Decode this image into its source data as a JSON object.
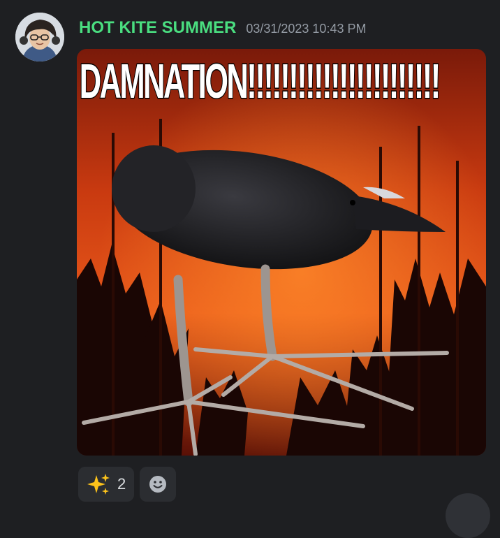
{
  "message": {
    "username": "HOT KITE SUMMER",
    "timestamp": "03/31/2023 10:43 PM",
    "username_color": "#4ade80",
    "avatar_icon": "user-avatar"
  },
  "attachment": {
    "caption": "DAMNATION!!!!!!!!!!!!!!!!!!!!!!!",
    "subject": "crow standing in front of a forest fire"
  },
  "reactions": [
    {
      "emoji_icon": "sparkles-icon",
      "count": "2"
    }
  ],
  "add_reaction_icon": "smiley-add-reaction-icon"
}
